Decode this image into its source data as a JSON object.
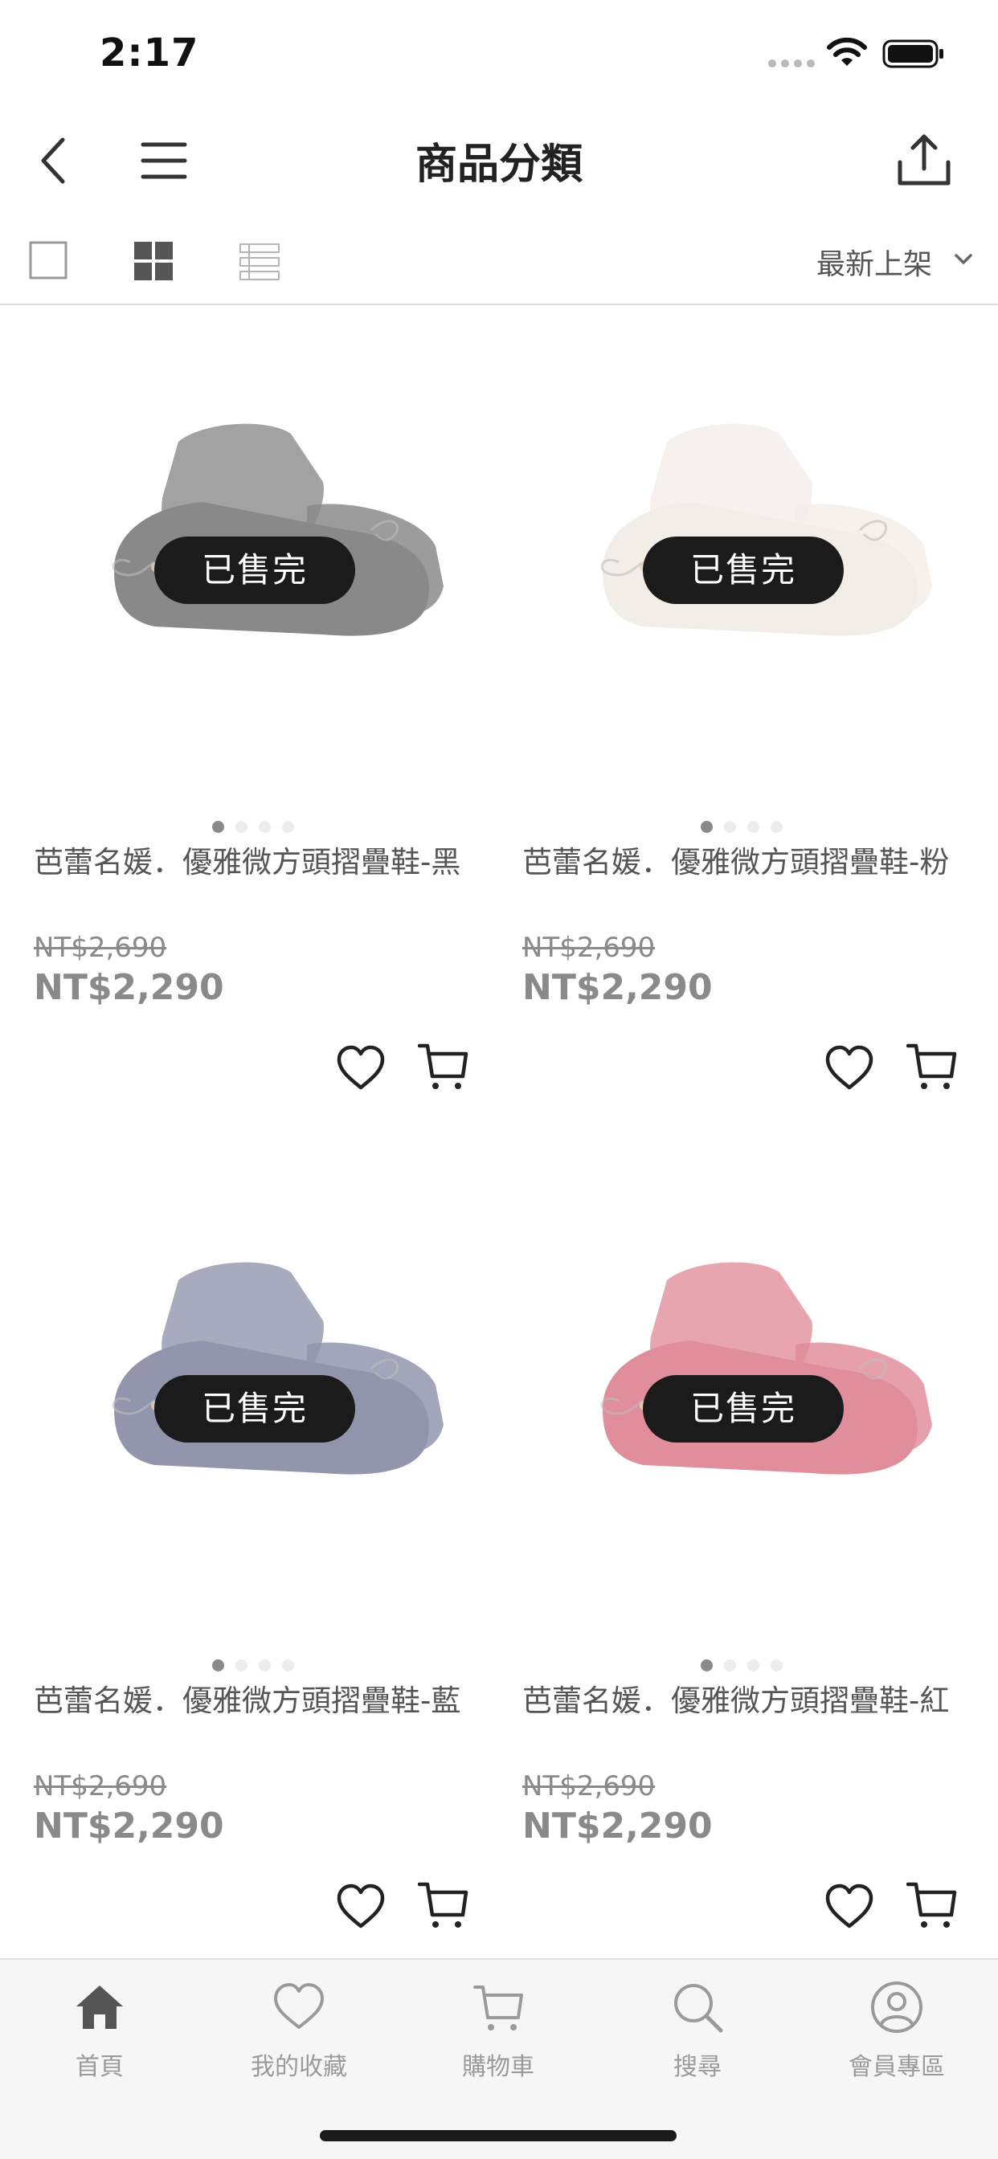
{
  "status_bar": {
    "time": "2:17"
  },
  "nav": {
    "title": "商品分類",
    "icons": [
      "back-icon",
      "menu-icon",
      "share-icon"
    ]
  },
  "toolbar": {
    "layouts": [
      "single-layout-icon",
      "grid-layout-icon",
      "list-layout-icon"
    ],
    "active_layout": "grid",
    "sort_label": "最新上架"
  },
  "products": [
    {
      "name": "芭蕾名媛．優雅微方頭摺疊鞋-黑",
      "original_price": "NT$2,690",
      "price": "NT$2,290",
      "badge": "已售完",
      "shoe_color": "#2a2a2a",
      "image_count": 4,
      "active_image": 1
    },
    {
      "name": "芭蕾名媛．優雅微方頭摺疊鞋-粉",
      "original_price": "NT$2,690",
      "price": "NT$2,290",
      "badge": "已售完",
      "shoe_color": "#eadfd7",
      "image_count": 4,
      "active_image": 1
    },
    {
      "name": "芭蕾名媛．優雅微方頭摺疊鞋-藍",
      "original_price": "NT$2,690",
      "price": "NT$2,290",
      "badge": "已售完",
      "shoe_color": "#3a3f6a",
      "image_count": 4,
      "active_image": 1
    },
    {
      "name": "芭蕾名媛．優雅微方頭摺疊鞋-紅",
      "original_price": "NT$2,690",
      "price": "NT$2,290",
      "badge": "已售完",
      "shoe_color": "#c8324a",
      "image_count": 4,
      "active_image": 1
    }
  ],
  "tabbar": {
    "items": [
      {
        "label": "首頁",
        "icon": "home-icon",
        "active": true
      },
      {
        "label": "我的收藏",
        "icon": "heart-icon",
        "active": false
      },
      {
        "label": "購物車",
        "icon": "cart-icon",
        "active": false
      },
      {
        "label": "搜尋",
        "icon": "search-icon",
        "active": false
      },
      {
        "label": "會員專區",
        "icon": "user-icon",
        "active": false
      }
    ]
  }
}
